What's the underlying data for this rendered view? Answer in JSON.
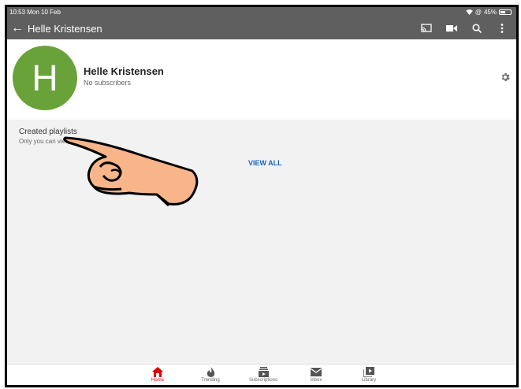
{
  "status_bar": {
    "time_date": "10:53  Mon 10 Feb",
    "battery": "45%"
  },
  "app_bar": {
    "back_icon": "←",
    "title": "Helle Kristensen",
    "actions": [
      "cast-icon",
      "video-camera-icon",
      "search-icon",
      "more-vert-icon"
    ]
  },
  "channel": {
    "avatar_letter": "H",
    "avatar_color": "#6aa23a",
    "name": "Helle Kristensen",
    "subscribers": "No subscribers"
  },
  "section": {
    "title": "Created playlists",
    "subtitle": "Only you can view",
    "view_all": "VIEW ALL"
  },
  "bottom_nav": [
    {
      "label": "Home",
      "icon": "home-icon",
      "active": true
    },
    {
      "label": "Trending",
      "icon": "flame-icon",
      "active": false
    },
    {
      "label": "Subscriptions",
      "icon": "subscriptions-icon",
      "active": false
    },
    {
      "label": "Inbox",
      "icon": "inbox-icon",
      "active": false
    },
    {
      "label": "Library",
      "icon": "library-icon",
      "active": false
    }
  ],
  "colors": {
    "accent": "#e00000",
    "link": "#1565c0",
    "appbar": "#5f5f5f"
  }
}
